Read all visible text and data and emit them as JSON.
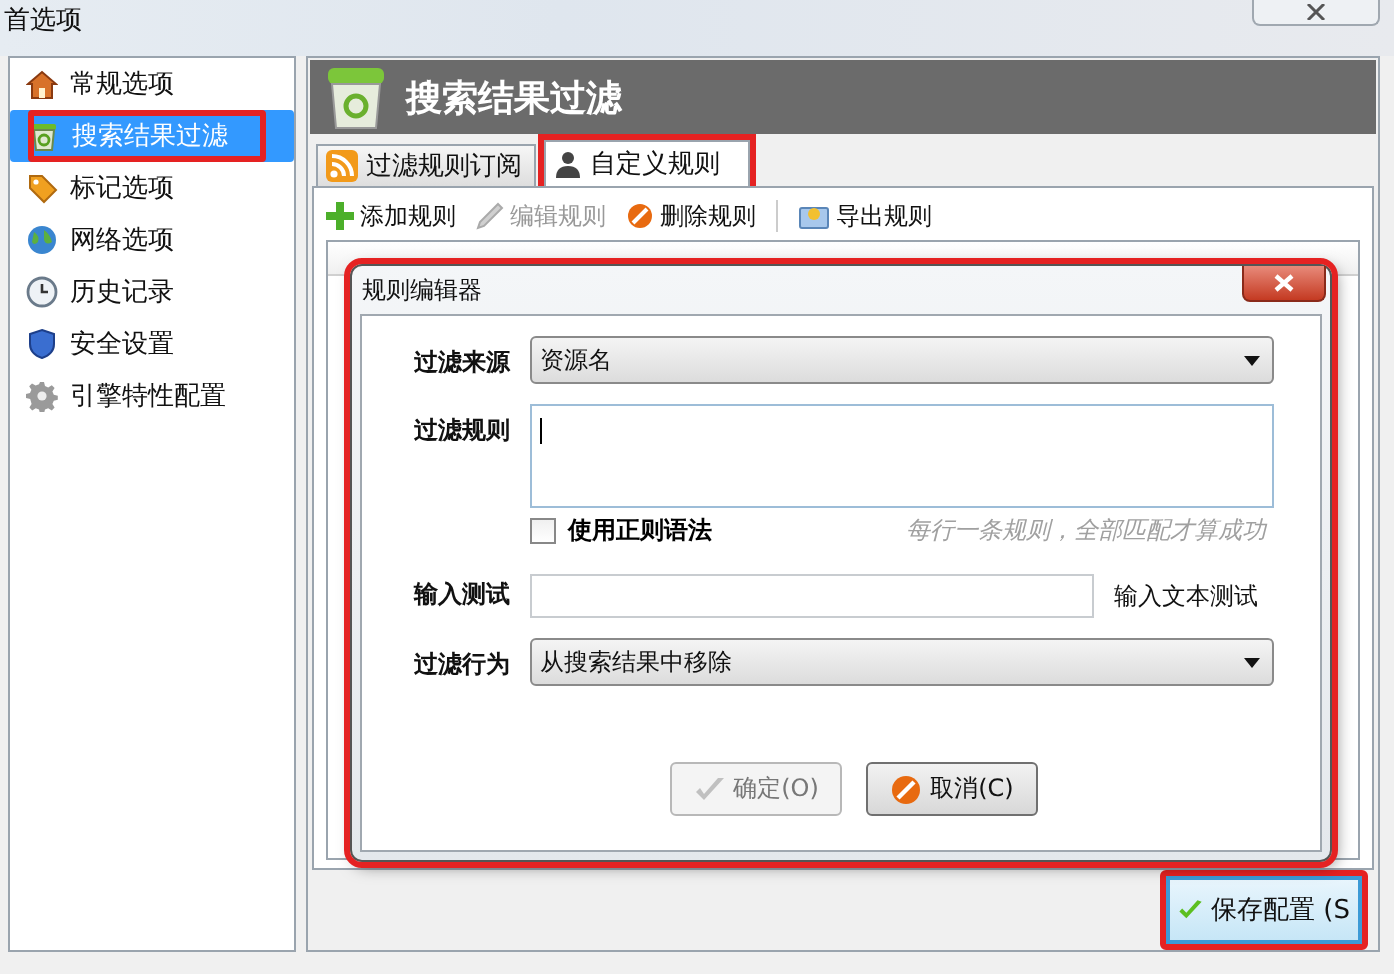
{
  "window": {
    "title": "首选项"
  },
  "sidebar": {
    "items": [
      {
        "label": "常规选项",
        "selected": false,
        "highlighted": false
      },
      {
        "label": "搜索结果过滤",
        "selected": true,
        "highlighted": true
      },
      {
        "label": "标记选项",
        "selected": false,
        "highlighted": false
      },
      {
        "label": "网络选项",
        "selected": false,
        "highlighted": false
      },
      {
        "label": "历史记录",
        "selected": false,
        "highlighted": false
      },
      {
        "label": "安全设置",
        "selected": false,
        "highlighted": false
      },
      {
        "label": "引擎特性配置",
        "selected": false,
        "highlighted": false
      }
    ]
  },
  "panel": {
    "title": "搜索结果过滤"
  },
  "tabs": [
    {
      "label": "过滤规则订阅",
      "selected": false,
      "highlighted": false
    },
    {
      "label": "自定义规则",
      "selected": true,
      "highlighted": true
    }
  ],
  "toolbar": [
    {
      "label": "添加规则",
      "disabled": false
    },
    {
      "label": "编辑规则",
      "disabled": true
    },
    {
      "label": "删除规则",
      "disabled": false
    },
    {
      "label": "导出规则",
      "disabled": false
    }
  ],
  "dialog": {
    "title": "规则编辑器",
    "highlighted": true,
    "fields": [
      {
        "kind": "select",
        "label": "过滤来源",
        "value": "资源名"
      },
      {
        "kind": "textarea",
        "label": "过滤规则",
        "focused": true
      },
      {
        "kind": "checkbox",
        "label": "使用正则语法",
        "checked": false,
        "hint": "每行一条规则，全部匹配才算成功"
      },
      {
        "kind": "input",
        "label": "输入测试",
        "note": "输入文本测试"
      },
      {
        "kind": "select",
        "label": "过滤行为",
        "value": "从搜索结果中移除"
      }
    ],
    "buttons": [
      {
        "label": "确定(O)",
        "disabled": true
      },
      {
        "label": "取消(C)",
        "disabled": false
      }
    ]
  },
  "save_button": {
    "label": "保存配置 (S",
    "highlighted": true
  }
}
